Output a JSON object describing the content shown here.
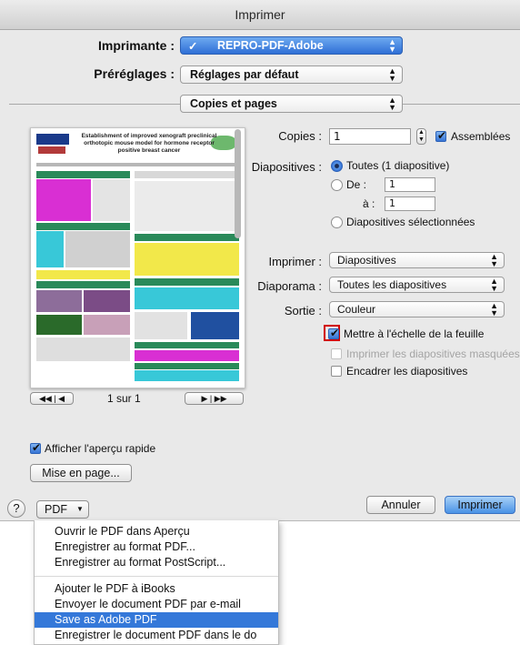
{
  "window": {
    "title": "Imprimer"
  },
  "printer": {
    "label": "Imprimante :",
    "value": "REPRO-PDF-Adobe",
    "check": "✓"
  },
  "presets": {
    "label": "Préréglages :",
    "value": "Réglages par défaut"
  },
  "section": {
    "value": "Copies et pages"
  },
  "preview": {
    "poster_title": "Establishment of improved xenograft preclinical orthotopic mouse model for hormone receptor positive breast cancer",
    "page_indicator": "1 sur 1",
    "quick_preview_label": "Afficher l'aperçu rapide",
    "quick_preview_checked": true,
    "page_setup_button": "Mise en page..."
  },
  "copies": {
    "label": "Copies :",
    "value": "1",
    "collated_label": "Assemblées",
    "collated_checked": true
  },
  "slides": {
    "label": "Diapositives :",
    "all_label": "Toutes (1 diapositive)",
    "from_label": "De :",
    "from_value": "1",
    "to_label": "à :",
    "to_value": "1",
    "selected_label": "Diapositives sélectionnées",
    "selected_option": "all"
  },
  "print_what": {
    "label": "Imprimer :",
    "value": "Diapositives"
  },
  "slideshow": {
    "label": "Diaporama :",
    "value": "Toutes les diapositives"
  },
  "output": {
    "label": "Sortie :",
    "value": "Couleur"
  },
  "options": {
    "scale_to_fit": {
      "label": "Mettre à l'échelle de la feuille",
      "checked": true
    },
    "print_hidden": {
      "label": "Imprimer les diapositives masquées",
      "checked": false
    },
    "frame_slides": {
      "label": "Encadrer les diapositives",
      "checked": false
    }
  },
  "footer": {
    "help": "?",
    "pdf_button": "PDF",
    "cancel_button": "Annuler",
    "print_button": "Imprimer"
  },
  "pdf_menu": {
    "items": [
      "Ouvrir le PDF dans Aperçu",
      "Enregistrer au format PDF...",
      "Enregistrer au format PostScript...",
      "Ajouter le PDF à iBooks",
      "Envoyer le document PDF par e-mail",
      "Save as Adobe PDF",
      "Enregistrer le document PDF dans le do"
    ],
    "highlighted_index": 5
  },
  "colors": {
    "accent": "#3478d9",
    "highlight_box": "#d10000"
  }
}
